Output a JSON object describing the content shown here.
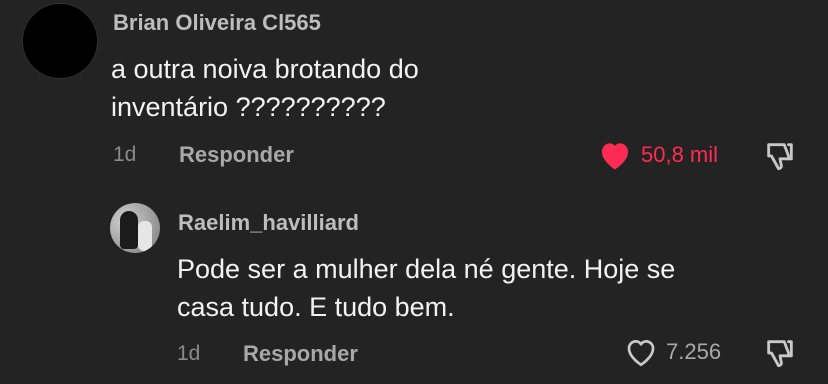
{
  "comments": [
    {
      "username": "Brian Oliveira Cl565",
      "text_line1": "a outra noiva brotando do",
      "text_line2": "inventário ??????????",
      "time": "1d",
      "reply_label": "Responder",
      "like_count": "50,8 mil",
      "liked": true,
      "like_color": "#fe2c55",
      "like_icon": "heart-filled-icon",
      "dislike_icon": "thumbs-down-icon"
    },
    {
      "username": "Raelim_havilliard",
      "text_line1": "Pode ser a mulher dela né gente. Hoje se",
      "text_line2": "casa tudo. E tudo bem.",
      "time": "1d",
      "reply_label": "Responder",
      "like_count": "7.256",
      "liked": false,
      "like_color": "#a8a8a8",
      "like_icon": "heart-outline-icon",
      "dislike_icon": "thumbs-down-icon"
    }
  ]
}
